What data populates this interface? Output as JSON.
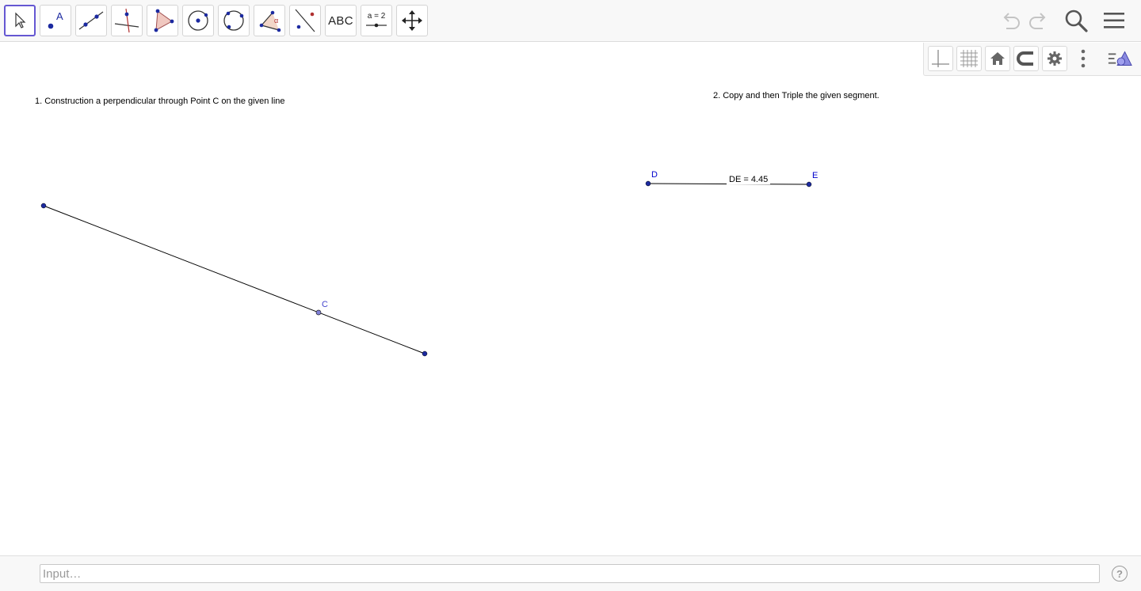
{
  "toolbar": {
    "tools": [
      {
        "name": "move-tool",
        "icon": "arrow-cursor-icon"
      },
      {
        "name": "point-tool",
        "icon": "point-icon",
        "label": "A"
      },
      {
        "name": "line-tool",
        "icon": "line-through-points-icon"
      },
      {
        "name": "perpendicular-line-tool",
        "icon": "perpendicular-icon"
      },
      {
        "name": "polygon-tool",
        "icon": "polygon-icon"
      },
      {
        "name": "circle-center-point-tool",
        "icon": "circle-center-icon"
      },
      {
        "name": "circle-three-points-tool",
        "icon": "circle-three-points-icon"
      },
      {
        "name": "angle-tool",
        "icon": "angle-icon",
        "label": "α"
      },
      {
        "name": "reflect-tool",
        "icon": "reflect-about-line-icon"
      },
      {
        "name": "text-tool",
        "icon": "text-icon",
        "label": "ABC"
      },
      {
        "name": "slider-tool",
        "icon": "slider-icon",
        "label": "a = 2"
      },
      {
        "name": "move-graphics-view-tool",
        "icon": "move-arrows-icon"
      }
    ],
    "selected_tool": "move-tool",
    "right_buttons": [
      "undo-icon",
      "redo-icon",
      "search-icon",
      "menu-icon"
    ]
  },
  "stylebar": {
    "buttons": [
      "axes-icon",
      "grid-icon",
      "home-icon",
      "point-capture-icon",
      "settings-icon",
      "more-vertical-icon",
      "algebra-toggle-icon"
    ]
  },
  "canvas": {
    "task1": "1. Construction a perpendicular through Point C on the given line",
    "task2": "2. Copy and then Triple the given segment.",
    "point_c": "C",
    "point_d": "D",
    "point_e": "E",
    "segment_label": "DE = 4.45",
    "colors": {
      "point": "#0000cc",
      "point_light": "#4444cc",
      "line": "#000000"
    }
  },
  "inputbar": {
    "placeholder": "Input…",
    "help": "?"
  }
}
